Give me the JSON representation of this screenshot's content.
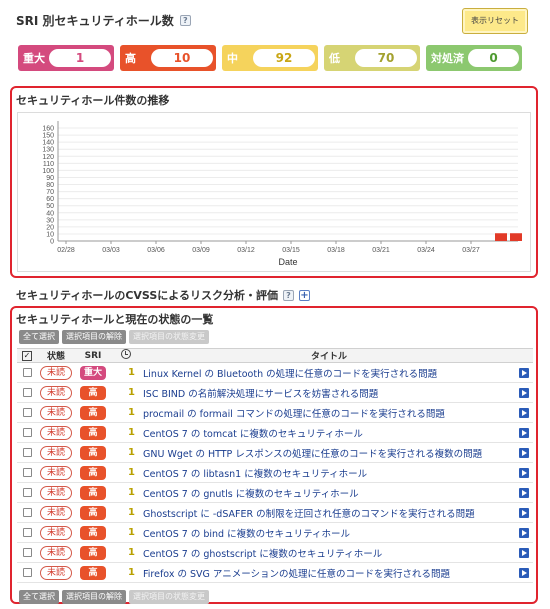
{
  "header": {
    "title": "SRI 別セキュリティホール数",
    "reset_button": "表示リセット"
  },
  "counts": [
    {
      "label": "重大",
      "value": "1",
      "color": "#d44a7e",
      "value_color": "#d44a7e"
    },
    {
      "label": "高",
      "value": "10",
      "color": "#e8522a",
      "value_color": "#e8522a"
    },
    {
      "label": "中",
      "value": "92",
      "color": "#f5d35c",
      "value_color": "#c9a614"
    },
    {
      "label": "低",
      "value": "70",
      "color": "#d6d474",
      "value_color": "#a3a12f"
    },
    {
      "label": "対処済",
      "value": "0",
      "color": "#8cc86f",
      "value_color": "#4e9a30"
    }
  ],
  "trend_panel": {
    "title": "セキュリティホール件数の推移"
  },
  "chart_data": {
    "type": "bar",
    "xlabel": "Date",
    "ylabel": "",
    "ylim": [
      0,
      170
    ],
    "yticks": [
      0,
      10,
      20,
      30,
      40,
      50,
      60,
      70,
      80,
      90,
      100,
      110,
      120,
      130,
      140,
      150,
      160
    ],
    "xtick_labels": [
      "02/28",
      "03/03",
      "03/06",
      "03/09",
      "03/12",
      "03/15",
      "03/18",
      "03/21",
      "03/24",
      "03/27"
    ],
    "series": [
      {
        "color": "#e23a28",
        "values": [
          {
            "date": "03/29",
            "value": 11
          },
          {
            "date": "03/30",
            "value": 11
          }
        ]
      }
    ],
    "grid": true
  },
  "cvss_heading": "セキュリティホールのCVSSによるリスク分析・評価",
  "list_panel": {
    "title": "セキュリティホールと現在の状態の一覧",
    "buttons": {
      "select_all": "全て選択",
      "deselect": "選択項目の解除",
      "change_status": "選択項目の状態変更"
    },
    "columns": {
      "status": "状態",
      "sri": "SRI",
      "title": "タイトル"
    },
    "rows": [
      {
        "status": "未読",
        "sri": "重大",
        "sri_color": "#d44a7e",
        "count": "1",
        "title": "Linux Kernel の Bluetooth の処理に任意のコードを実行される問題"
      },
      {
        "status": "未読",
        "sri": "高",
        "sri_color": "#e8522a",
        "count": "1",
        "title": "ISC BIND の名前解決処理にサービスを妨害される問題"
      },
      {
        "status": "未読",
        "sri": "高",
        "sri_color": "#e8522a",
        "count": "1",
        "title": "procmail の formail コマンドの処理に任意のコードを実行される問題"
      },
      {
        "status": "未読",
        "sri": "高",
        "sri_color": "#e8522a",
        "count": "1",
        "title": "CentOS 7 の tomcat に複数のセキュリティホール"
      },
      {
        "status": "未読",
        "sri": "高",
        "sri_color": "#e8522a",
        "count": "1",
        "title": "GNU Wget の HTTP レスポンスの処理に任意のコードを実行される複数の問題"
      },
      {
        "status": "未読",
        "sri": "高",
        "sri_color": "#e8522a",
        "count": "1",
        "title": "CentOS 7 の libtasn1 に複数のセキュリティホール"
      },
      {
        "status": "未読",
        "sri": "高",
        "sri_color": "#e8522a",
        "count": "1",
        "title": "CentOS 7 の gnutls に複数のセキュリティホール"
      },
      {
        "status": "未読",
        "sri": "高",
        "sri_color": "#e8522a",
        "count": "1",
        "title": "Ghostscript に -dSAFER の制限を迂回され任意のコマンドを実行される問題"
      },
      {
        "status": "未読",
        "sri": "高",
        "sri_color": "#e8522a",
        "count": "1",
        "title": "CentOS 7 の bind に複数のセキュリティホール"
      },
      {
        "status": "未読",
        "sri": "高",
        "sri_color": "#e8522a",
        "count": "1",
        "title": "CentOS 7 の ghostscript に複数のセキュリティホール"
      },
      {
        "status": "未読",
        "sri": "高",
        "sri_color": "#e8522a",
        "count": "1",
        "title": "Firefox の SVG アニメーションの処理に任意のコードを実行される問題"
      }
    ]
  }
}
